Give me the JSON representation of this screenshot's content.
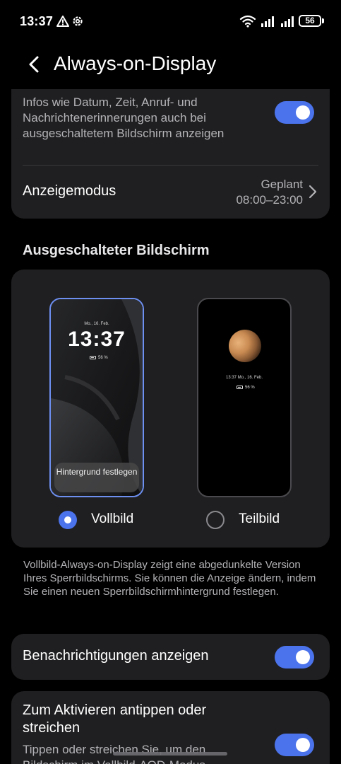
{
  "status_bar": {
    "time": "13:37",
    "battery_level": "56"
  },
  "header": {
    "title": "Always-on-Display"
  },
  "card_main": {
    "description": "Infos wie Datum, Zeit, Anruf- und Nachrichtenerinnerungen auch bei ausgeschaltetem Bildschirm anzeigen",
    "toggle_on": true,
    "display_mode_label": "Anzeigemodus",
    "display_mode_value_line1": "Geplant",
    "display_mode_value_line2": "08:00–23:00"
  },
  "section_screen_off": {
    "title": "Ausgeschalteter Bildschirm",
    "options": [
      {
        "label": "Vollbild",
        "selected": true,
        "preview_date": "Mo., 16. Feb.",
        "preview_time": "13:37",
        "preview_battery": "56 %",
        "button_label": "Hintergrund festlegen"
      },
      {
        "label": "Teilbild",
        "selected": false,
        "preview_info": "13:37 Mo., 16. Feb.",
        "preview_battery": "56 %"
      }
    ]
  },
  "info_text": "Vollbild-Always-on-Display zeigt eine abgedunkelte Version Ihres Sperrbildschirms. Sie können die Anzeige ändern, indem Sie einen neuen Sperrbildschirmhinter­grund festlegen.",
  "notifications": {
    "label": "Benachrichtigungen anzeigen",
    "toggle_on": true
  },
  "tap_to_activate": {
    "label": "Zum Aktivieren antippen oder streichen",
    "description": "Tippen oder streichen Sie, um den Bildschirm im Vollbild-AOD-Modus",
    "toggle_on": true
  },
  "colors": {
    "accent": "#4b73ec",
    "card_bg": "#1f1f21",
    "background": "#000000"
  }
}
